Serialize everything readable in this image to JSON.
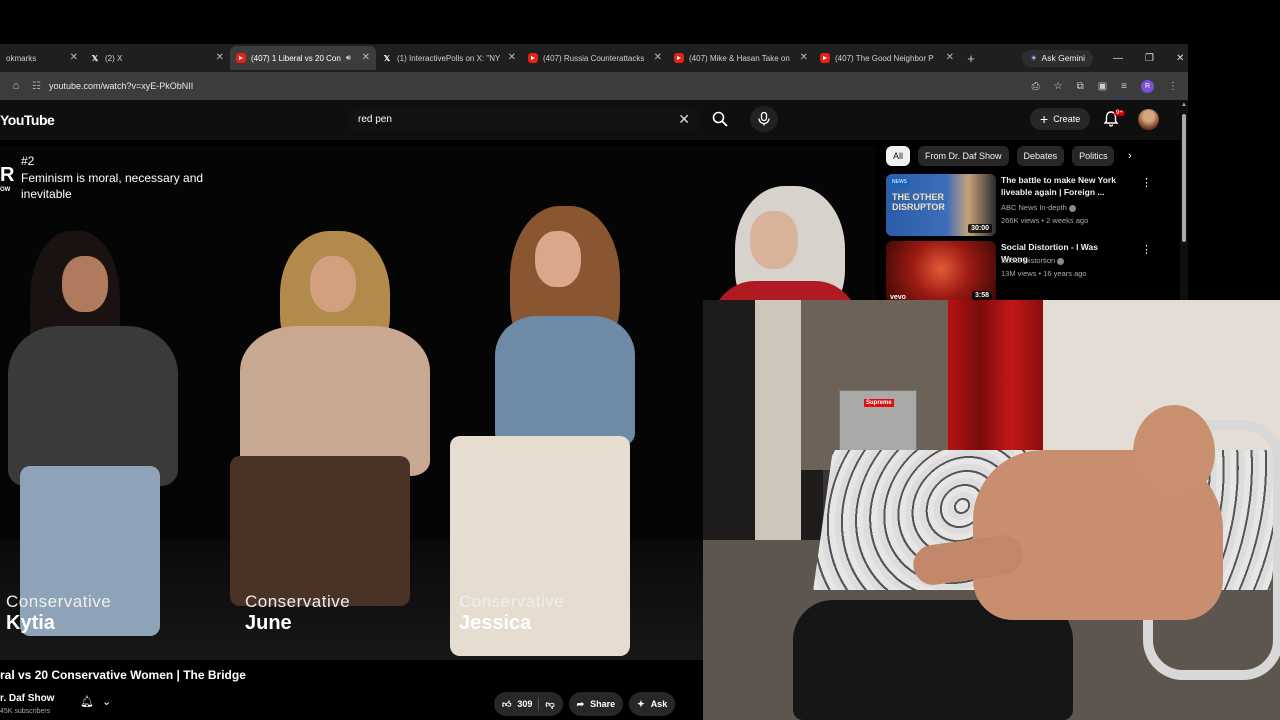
{
  "browser": {
    "tabs": [
      {
        "label": "okmarks",
        "icon": "none",
        "active": false
      },
      {
        "label": "(2) X",
        "icon": "x",
        "active": false
      },
      {
        "label": "(407) 1 Liberal vs 20 Con",
        "icon": "youtube",
        "active": true
      },
      {
        "label": "(1) InteractivePolls on X: \"NY",
        "icon": "x",
        "active": false
      },
      {
        "label": "(407) Russia Counterattacks",
        "icon": "youtube",
        "active": false
      },
      {
        "label": "(407) Mike & Hasan Take on",
        "icon": "youtube",
        "active": false
      },
      {
        "label": "(407) The Good Neighbor P",
        "icon": "youtube",
        "active": false
      }
    ],
    "gemini_label": "Ask Gemini",
    "url": "youtube.com/watch?v=xyE-PkObNII",
    "profile_initial": "R"
  },
  "youtube": {
    "logo": "YouTube",
    "search_value": "red pen",
    "create_label": "Create",
    "notification_count": "9+"
  },
  "video": {
    "episode_number": "#2",
    "episode_topic": "Feminism is moral, necessary and inevitable",
    "logo_text": "R",
    "logo_sub": "OW",
    "panelists": [
      {
        "role": "Conservative",
        "name": "Kytia"
      },
      {
        "role": "Conservative",
        "name": "June"
      },
      {
        "role": "Conservative",
        "name": "Jessica"
      }
    ],
    "title": "ral vs 20 Conservative Women | The Bridge",
    "channel": "r. Daf Show",
    "subscribers": "45K subscribers",
    "likes": "309",
    "share_label": "Share",
    "ask_label": "Ask"
  },
  "sidebar": {
    "chips": [
      "All",
      "From Dr. Daf Show",
      "Debates",
      "Politics"
    ],
    "recommendations": [
      {
        "title": "The battle to make New York liveable again | Foreign ...",
        "channel": "ABC News In-depth",
        "meta": "266K views • 2 weeks ago",
        "duration": "30:00",
        "thumb_text": "THE OTHER DISRUPTOR",
        "thumb_badge": "NEWS"
      },
      {
        "title": "Social Distortion - I Was Wrong",
        "channel": "Social Distortion",
        "meta": "13M views • 16 years ago",
        "duration": "3:58",
        "thumb_text": "vevo"
      }
    ]
  },
  "webcam": {
    "fridge_logo": "Supreme"
  },
  "colors": {
    "youtube_red": "#e62117",
    "background": "#0f0f0f",
    "chip_bg": "#272727"
  }
}
